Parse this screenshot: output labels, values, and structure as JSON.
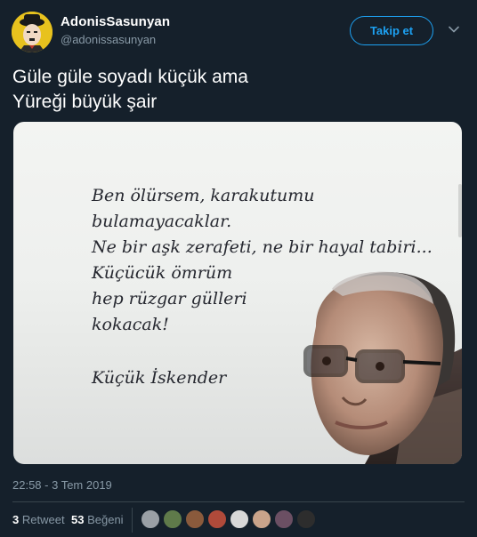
{
  "author": {
    "display_name": "AdonisSasunyan",
    "handle": "@adonissasunyan"
  },
  "follow_label": "Takip et",
  "tweet": {
    "text": "Güle güle soyadı küçük ama\nYüreği büyük şair"
  },
  "media": {
    "poem_lines": "Ben ölürsem, karakutumu\nbulamayacaklar.\nNe bir aşk zerafeti, ne bir hayal tabiri...\nKüçücük ömrüm\nhep rüzgar gülleri\nkokacak!",
    "poem_author": "Küçük İskender"
  },
  "timestamp": "22:58 - 3 Tem 2019",
  "stats": {
    "retweet_count": "3",
    "retweet_label": "Retweet",
    "like_count": "53",
    "like_label": "Beğeni"
  },
  "colors": {
    "background": "#15202b",
    "accent": "#1da1f2",
    "secondary_text": "#8899a6",
    "divider": "#38444d"
  }
}
